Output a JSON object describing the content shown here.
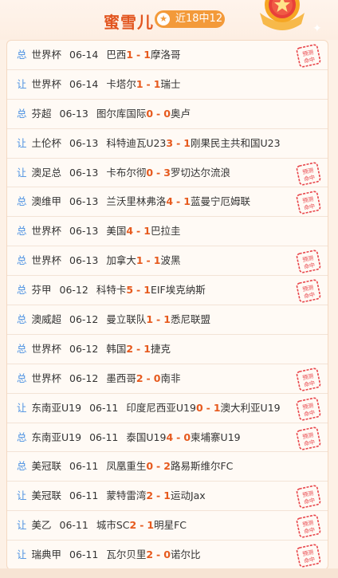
{
  "header": {
    "user_name": "蜜雪儿",
    "record_badge": "近18中12",
    "stamp_text_top": "预测",
    "stamp_text_bottom": "命中"
  },
  "colors": {
    "accent": "#e2551f",
    "badge_bg": "#f39a3a",
    "type_label": "#4a90e2",
    "score": "#e65a1e",
    "stamp": "#e8454a"
  },
  "predictions": [
    {
      "type": "总",
      "league": "世界杯",
      "date": "06-14",
      "home": "巴西",
      "home_score": "1",
      "away_score": "1",
      "away": "摩洛哥",
      "hit": true
    },
    {
      "type": "让",
      "league": "世界杯",
      "date": "06-14",
      "home": "卡塔尔",
      "home_score": "1",
      "away_score": "1",
      "away": "瑞士",
      "hit": false
    },
    {
      "type": "总",
      "league": "芬超",
      "date": "06-13",
      "home": "图尔库国际",
      "home_score": "0",
      "away_score": "0",
      "away": "奥卢",
      "hit": false
    },
    {
      "type": "让",
      "league": "土伦杯",
      "date": "06-13",
      "home": "科特迪瓦U23",
      "home_score": "3",
      "away_score": "1",
      "away": "刚果民主共和国U23",
      "hit": false
    },
    {
      "type": "让",
      "league": "澳足总",
      "date": "06-13",
      "home": "卡布尔彻",
      "home_score": "0",
      "away_score": "3",
      "away": "罗切达尔流浪",
      "hit": true
    },
    {
      "type": "总",
      "league": "澳维甲",
      "date": "06-13",
      "home": "兰沃里林弗洛",
      "home_score": "4",
      "away_score": "1",
      "away": "蓝曼宁厄姆联",
      "hit": true
    },
    {
      "type": "总",
      "league": "世界杯",
      "date": "06-13",
      "home": "美国",
      "home_score": "4",
      "away_score": "1",
      "away": "巴拉圭",
      "hit": false
    },
    {
      "type": "总",
      "league": "世界杯",
      "date": "06-13",
      "home": "加拿大",
      "home_score": "1",
      "away_score": "1",
      "away": "波黑",
      "hit": true
    },
    {
      "type": "总",
      "league": "芬甲",
      "date": "06-12",
      "home": "科特卡",
      "home_score": "5",
      "away_score": "1",
      "away": "EIF埃克纳斯",
      "hit": true
    },
    {
      "type": "总",
      "league": "澳威超",
      "date": "06-12",
      "home": "曼立联队",
      "home_score": "1",
      "away_score": "1",
      "away": "悉尼联盟",
      "hit": false
    },
    {
      "type": "总",
      "league": "世界杯",
      "date": "06-12",
      "home": "韩国",
      "home_score": "2",
      "away_score": "1",
      "away": "捷克",
      "hit": false
    },
    {
      "type": "总",
      "league": "世界杯",
      "date": "06-12",
      "home": "墨西哥",
      "home_score": "2",
      "away_score": "0",
      "away": "南非",
      "hit": true
    },
    {
      "type": "让",
      "league": "东南亚U19",
      "date": "06-11",
      "home": "印度尼西亚U19",
      "home_score": "0",
      "away_score": "1",
      "away": "澳大利亚U19",
      "hit": true
    },
    {
      "type": "总",
      "league": "东南亚U19",
      "date": "06-11",
      "home": "泰国U19",
      "home_score": "4",
      "away_score": "0",
      "away": "柬埔寨U19",
      "hit": true
    },
    {
      "type": "总",
      "league": "美冠联",
      "date": "06-11",
      "home": "凤凰重生",
      "home_score": "0",
      "away_score": "2",
      "away": "路易斯维尔FC",
      "hit": false
    },
    {
      "type": "让",
      "league": "美冠联",
      "date": "06-11",
      "home": "蒙特雷湾",
      "home_score": "2",
      "away_score": "1",
      "away": "运动Jax",
      "hit": true
    },
    {
      "type": "让",
      "league": "美乙",
      "date": "06-11",
      "home": "城市SC",
      "home_score": "2",
      "away_score": "1",
      "away": "明星FC",
      "hit": true
    },
    {
      "type": "让",
      "league": "瑞典甲",
      "date": "06-11",
      "home": "瓦尔贝里",
      "home_score": "2",
      "away_score": "0",
      "away": "诺尔比",
      "hit": true
    }
  ]
}
